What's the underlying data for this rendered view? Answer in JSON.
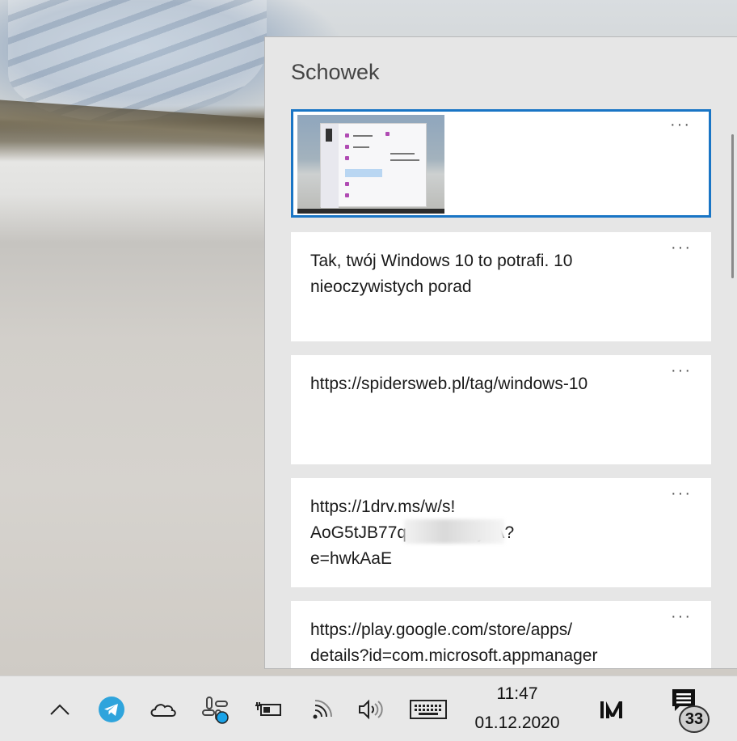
{
  "panel": {
    "title": "Schowek",
    "more_label": "···",
    "items": [
      {
        "type": "image"
      },
      {
        "type": "text",
        "text": "Tak, twój Windows 10 to potrafi. 10\nnieoczywistych porad"
      },
      {
        "type": "text",
        "text": "https://spidersweb.pl/tag/windows-10"
      },
      {
        "type": "text",
        "text": "https://1drv.ms/w/s!\nAoG5tJB77qJ                    OwPHbjEA?\ne=hwkAaE"
      },
      {
        "type": "text",
        "text": "https://play.google.com/store/apps/\ndetails?id=com.microsoft.appmanager"
      }
    ]
  },
  "taskbar": {
    "time": "11:47",
    "date": "01.12.2020",
    "notification_count": "33",
    "accent": "#1975c5",
    "icons": [
      "chevron-up-icon",
      "telegram-icon",
      "onedrive-icon",
      "slack-icon",
      "battery-icon",
      "wifi-icon",
      "volume-icon",
      "keyboard-icon",
      "m-logo-icon",
      "notification-icon"
    ]
  }
}
